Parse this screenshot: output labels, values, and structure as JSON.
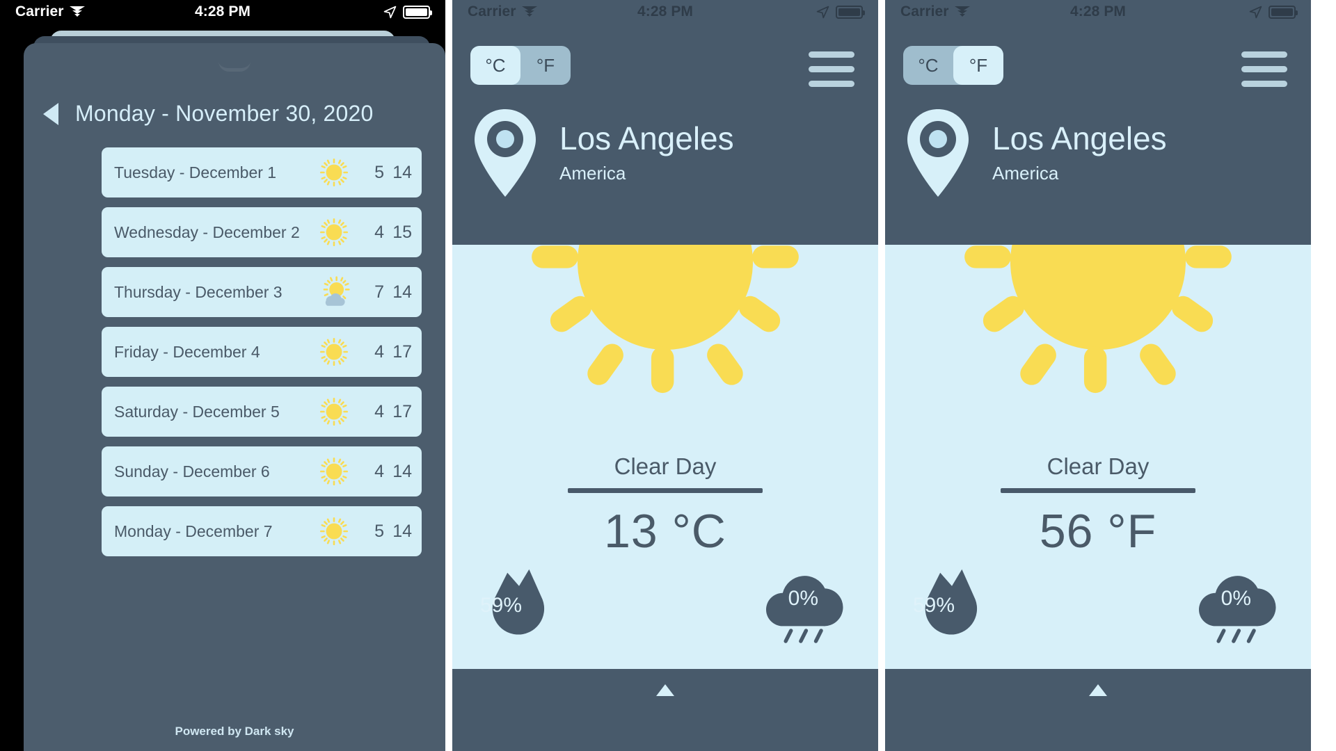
{
  "status_bar": {
    "carrier": "Carrier",
    "time": "4:28 PM",
    "wifi_icon": "wifi-icon",
    "location_icon": "location-arrow-icon",
    "battery_icon": "battery-icon"
  },
  "panel_forecast": {
    "back_icon": "back-arrow-icon",
    "title": "Monday - November 30, 2020",
    "footer": "Powered by Dark sky",
    "rows": [
      {
        "label": "Tuesday - December 1",
        "icon": "clear-day-icon",
        "low": "5",
        "high": "14"
      },
      {
        "label": "Wednesday - December 2",
        "icon": "clear-day-icon",
        "low": "4",
        "high": "15"
      },
      {
        "label": "Thursday - December 3",
        "icon": "partly-cloudy-day-icon",
        "low": "7",
        "high": "14"
      },
      {
        "label": "Friday - December 4",
        "icon": "clear-day-icon",
        "low": "4",
        "high": "17"
      },
      {
        "label": "Saturday - December 5",
        "icon": "clear-day-icon",
        "low": "4",
        "high": "17"
      },
      {
        "label": "Sunday - December 6",
        "icon": "clear-day-icon",
        "low": "4",
        "high": "14"
      },
      {
        "label": "Monday - December 7",
        "icon": "clear-day-icon",
        "low": "5",
        "high": "14"
      }
    ]
  },
  "panel_celsius": {
    "units": {
      "celsius_label": "°C",
      "fahrenheit_label": "°F",
      "selected": "°C"
    },
    "menu_icon": "hamburger-menu-icon",
    "location_pin_icon": "map-pin-icon",
    "city": "Los Angeles",
    "region": "America",
    "weather_icon": "clear-day-icon",
    "condition": "Clear Day",
    "temperature": "13 °C",
    "humidity": "59%",
    "humidity_icon": "humidity-droplet-icon",
    "precipitation": "0%",
    "precipitation_icon": "rain-cloud-icon",
    "expand_icon": "chevron-up-icon"
  },
  "panel_fahrenheit": {
    "units": {
      "celsius_label": "°C",
      "fahrenheit_label": "°F",
      "selected": "°F"
    },
    "menu_icon": "hamburger-menu-icon",
    "location_pin_icon": "map-pin-icon",
    "city": "Los Angeles",
    "region": "America",
    "weather_icon": "clear-day-icon",
    "condition": "Clear Day",
    "temperature": "56 °F",
    "humidity": "59%",
    "humidity_icon": "humidity-droplet-icon",
    "precipitation": "0%",
    "precipitation_icon": "rain-cloud-icon",
    "expand_icon": "chevron-up-icon"
  },
  "colors": {
    "slate": "#485a6b",
    "slate_dark": "#3f4f5f",
    "pale_blue": "#d7f0f9",
    "sun_yellow": "#f9dc53",
    "cloud_grey": "#a7c4d6",
    "toggle_track": "#9fbdcd"
  }
}
